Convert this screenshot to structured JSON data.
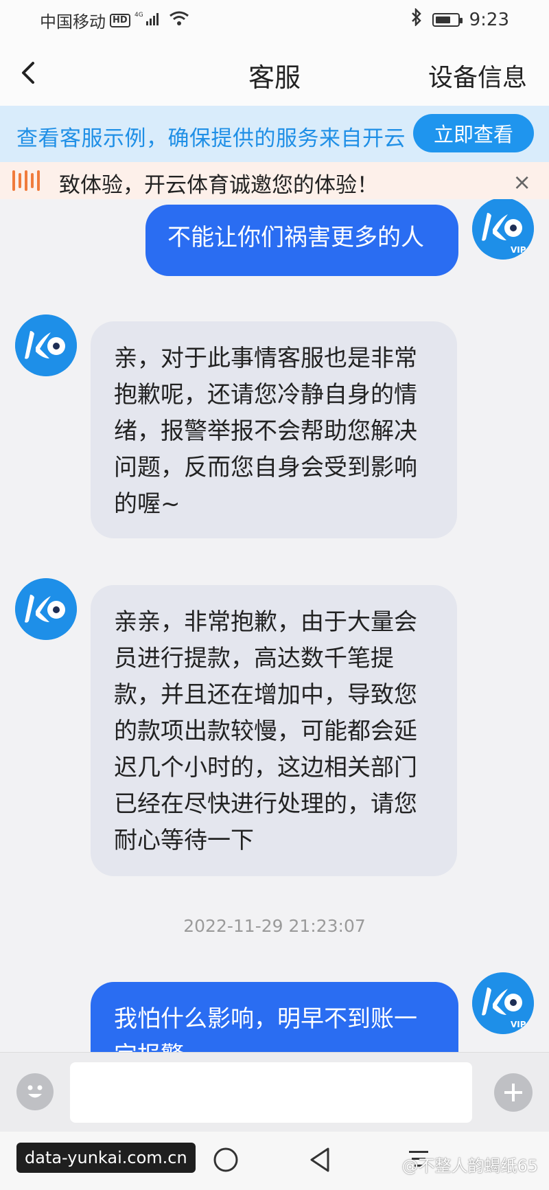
{
  "status_bar": {
    "carrier": "中国移动",
    "hd": "HD",
    "network": "4G",
    "time": "9:23",
    "battery_level": 0.7,
    "icons": [
      "signal-icon",
      "wifi-icon",
      "bluetooth-icon",
      "battery-icon"
    ]
  },
  "header": {
    "back_icon": "chevron-left-icon",
    "title": "客服",
    "device_info": "设备信息"
  },
  "banner": {
    "text": "查看客服示例，确保提供的服务来自开云",
    "button": "立即查看"
  },
  "notice": {
    "icon": "announcement-icon",
    "text": "致体验，开云体育诚邀您的体验！",
    "close": "×"
  },
  "messages": [
    {
      "role": "user",
      "text": "不能让你们祸害更多的人",
      "avatar_text": "VIP"
    },
    {
      "role": "agent",
      "lines": [
        "亲，对于此事情客服也是非常",
        "抱歉呢，还请您冷静自身的情",
        "绪，报警举报不会帮助您解决",
        "问题，反而您自身会受到影响",
        "的喔~"
      ]
    },
    {
      "role": "agent",
      "lines": [
        "亲亲，非常抱歉，由于大量会",
        "员进行提款，高达数千笔提",
        "款，并且还在增加中，导致您",
        "的款项出款较慢，可能都会延",
        "迟几个小时的，这边相关部门",
        "已经在尽快进行处理的，请您",
        "耐心等待一下"
      ]
    },
    {
      "role": "timestamp",
      "text": "2022-11-29 21:23:07"
    },
    {
      "role": "user",
      "lines": [
        "我怕什么影响，明早不到账一",
        "定报警"
      ],
      "avatar_text": "VIP"
    }
  ],
  "input": {
    "placeholder": "",
    "emoji_icon": "emoji-icon",
    "plus_icon": "plus-icon"
  },
  "watermarks": {
    "left": "data-yunkai.com.cn",
    "right": "@不整人韵蝎纸65"
  },
  "colors": {
    "accent_blue": "#1f95ee",
    "user_bubble": "#2a6df2",
    "agent_bubble": "#e4e6ee",
    "banner_bg": "#d9ecfb",
    "notice_bg": "#fdf0ea"
  }
}
